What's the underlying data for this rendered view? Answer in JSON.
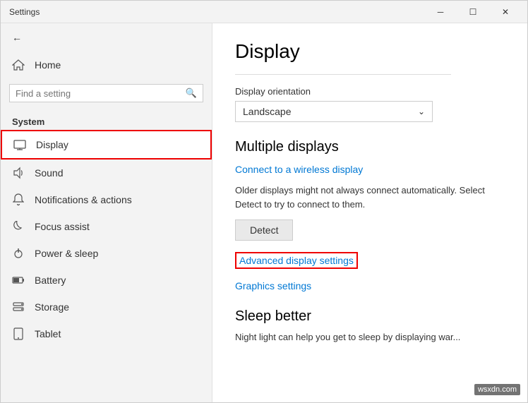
{
  "titlebar": {
    "title": "Settings",
    "min_label": "─",
    "max_label": "☐",
    "close_label": "✕"
  },
  "sidebar": {
    "back_label": "",
    "home_label": "Home",
    "search_placeholder": "Find a setting",
    "section_label": "System",
    "items": [
      {
        "id": "display",
        "label": "Display",
        "icon": "monitor",
        "active": true
      },
      {
        "id": "sound",
        "label": "Sound",
        "icon": "sound"
      },
      {
        "id": "notifications",
        "label": "Notifications & actions",
        "icon": "bell"
      },
      {
        "id": "focus",
        "label": "Focus assist",
        "icon": "moon"
      },
      {
        "id": "power",
        "label": "Power & sleep",
        "icon": "power"
      },
      {
        "id": "battery",
        "label": "Battery",
        "icon": "battery"
      },
      {
        "id": "storage",
        "label": "Storage",
        "icon": "storage"
      },
      {
        "id": "tablet",
        "label": "Tablet",
        "icon": "tablet"
      }
    ]
  },
  "main": {
    "page_title": "Display",
    "orientation_label": "Display orientation",
    "orientation_value": "Landscape",
    "multiple_displays_heading": "Multiple displays",
    "wireless_link": "Connect to a wireless display",
    "info_text": "Older displays might not always connect automatically. Select Detect to try to connect to them.",
    "detect_button": "Detect",
    "advanced_display_link": "Advanced display settings",
    "graphics_link": "Graphics settings",
    "sleep_heading": "Sleep better",
    "sleep_text": "Night light can help you get to sleep by displaying war..."
  },
  "watermark": {
    "text": "wsxdn.com"
  }
}
